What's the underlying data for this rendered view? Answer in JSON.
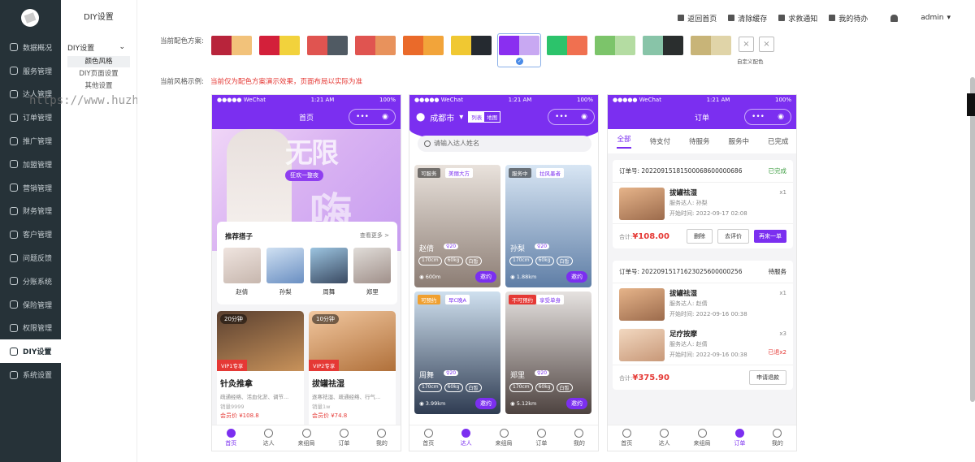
{
  "sidebar": {
    "items": [
      {
        "label": "数据概况"
      },
      {
        "label": "服务管理"
      },
      {
        "label": "达人管理"
      },
      {
        "label": "订单管理"
      },
      {
        "label": "推广管理"
      },
      {
        "label": "加盟管理"
      },
      {
        "label": "营销管理"
      },
      {
        "label": "财务管理"
      },
      {
        "label": "客户管理"
      },
      {
        "label": "问题反馈"
      },
      {
        "label": "分账系统"
      },
      {
        "label": "保险管理"
      },
      {
        "label": "权限管理"
      },
      {
        "label": "DIY设置"
      },
      {
        "label": "系统设置"
      }
    ]
  },
  "submenu": {
    "title": "DIY设置",
    "group": "DIY设置",
    "items": [
      "颜色风格",
      "DIY页面设置",
      "其他设置"
    ]
  },
  "topbar": {
    "home": "返回首页",
    "clear_cache": "清除缓存",
    "help": "求救通知",
    "todo": "我的待办",
    "user": "admin"
  },
  "scheme": {
    "label": "当前配色方案:",
    "custom_label": "自定义配色",
    "swatches": [
      [
        "#b8243b",
        "#f2c27a"
      ],
      [
        "#d3203a",
        "#f2d23c"
      ],
      [
        "#e05450",
        "#505a63"
      ],
      [
        "#e05450",
        "#e8925c"
      ],
      [
        "#ea6a2a",
        "#f2a43a"
      ],
      [
        "#f0c832",
        "#252a30"
      ],
      [
        "#8a2ff0",
        "#c8a8f2"
      ],
      [
        "#2cc36b",
        "#f07050"
      ],
      [
        "#7cc46a",
        "#b4dca2"
      ],
      [
        "#88c4a8",
        "#2a2e2e"
      ],
      [
        "#c8b478",
        "#e0d4a8"
      ]
    ]
  },
  "example": {
    "label": "当前风格示例:",
    "tip": "当前仅为配色方案演示效果，页面布局以实际为准"
  },
  "watermark": "https://www.huzhan.com/ishop45282",
  "phone1": {
    "status_left": "●●●●● WeChat",
    "time": "1:21 AM",
    "battery": "100%",
    "title": "首页",
    "banner_big": "无限",
    "banner_tag": "狂欢一整夜",
    "banner_big2": "嗨",
    "rec_title": "推荐搭子",
    "rec_more": "查看更多 >",
    "people": [
      "赵倩",
      "孙梨",
      "周舞",
      "郑里"
    ],
    "services": [
      {
        "time": "20分钟",
        "vip": "VIP1专享",
        "name": "针灸推拿",
        "desc": "疏通经络、活血化淤、调节...",
        "sold": "销量9999",
        "price": "会员价 ¥108.8"
      },
      {
        "time": "10分钟",
        "vip": "VIP2专享",
        "name": "拔罐祛湿",
        "desc": "逐寒祛湿、疏通经络、行气...",
        "sold": "销量1w",
        "price": "会员价 ¥74.8"
      }
    ],
    "tabs": [
      "首页",
      "达人",
      "来组局",
      "订单",
      "我的"
    ]
  },
  "phone2": {
    "time": "1:21 AM",
    "battery": "100%",
    "city": "成都市",
    "mode_list": "列表",
    "mode_map": "地图",
    "search_placeholder": "请输入达人姓名",
    "talents": [
      {
        "status": "可服务",
        "tag": "美丽大方",
        "name": "赵倩",
        "age": "20",
        "h": "170cm",
        "w": "60kg",
        "skin": "白皙",
        "dist": "600m",
        "btn": "邀约"
      },
      {
        "status": "服务中",
        "tag": "拉风墨者",
        "name": "孙梨",
        "age": "20",
        "h": "170cm",
        "w": "60kg",
        "skin": "白皙",
        "dist": "1.88km",
        "btn": "邀约"
      },
      {
        "status": "可预约",
        "tag": "早C晚A",
        "name": "周舞",
        "age": "20",
        "h": "170cm",
        "w": "60kg",
        "skin": "白皙",
        "dist": "3.99km",
        "btn": "邀约"
      },
      {
        "status": "不可预约",
        "tag": "享受单身",
        "name": "郑里",
        "age": "20",
        "h": "170cm",
        "w": "60kg",
        "skin": "白皙",
        "dist": "5.12km",
        "btn": "邀约"
      }
    ],
    "tabs": [
      "首页",
      "达人",
      "来组局",
      "订单",
      "我的"
    ]
  },
  "phone3": {
    "status_left": "●●●●● WeChat",
    "time": "1:21 AM",
    "battery": "100%",
    "title": "订单",
    "order_tabs": [
      "全部",
      "待支付",
      "待服务",
      "服务中",
      "已完成"
    ],
    "orders": [
      {
        "no": "订单号: 20220915181500068600000686",
        "status": "已完成",
        "items": [
          {
            "name": "拔罐祛湿",
            "staff": "服务达人: 孙梨",
            "start": "开始时间: 2022-09-17 02:08",
            "qty": "x1",
            "ret": ""
          }
        ],
        "total_label": "合计:",
        "total": "¥108.00",
        "btns": [
          "删除",
          "去评价",
          "再来一单"
        ]
      },
      {
        "no": "订单号: 20220915171623025600000256",
        "status": "待服务",
        "items": [
          {
            "name": "拔罐祛湿",
            "staff": "服务达人: 赵倩",
            "start": "开始时间: 2022-09-16 00:38",
            "qty": "x1",
            "ret": ""
          },
          {
            "name": "足疗按摩",
            "staff": "服务达人: 赵倩",
            "start": "开始时间: 2022-09-16 00:38",
            "qty": "x3",
            "ret": "已退x2"
          }
        ],
        "total_label": "合计:",
        "total": "¥375.90",
        "btns": [
          "申请退款"
        ]
      }
    ],
    "tabs": [
      "首页",
      "达人",
      "来组局",
      "订单",
      "我的"
    ]
  }
}
